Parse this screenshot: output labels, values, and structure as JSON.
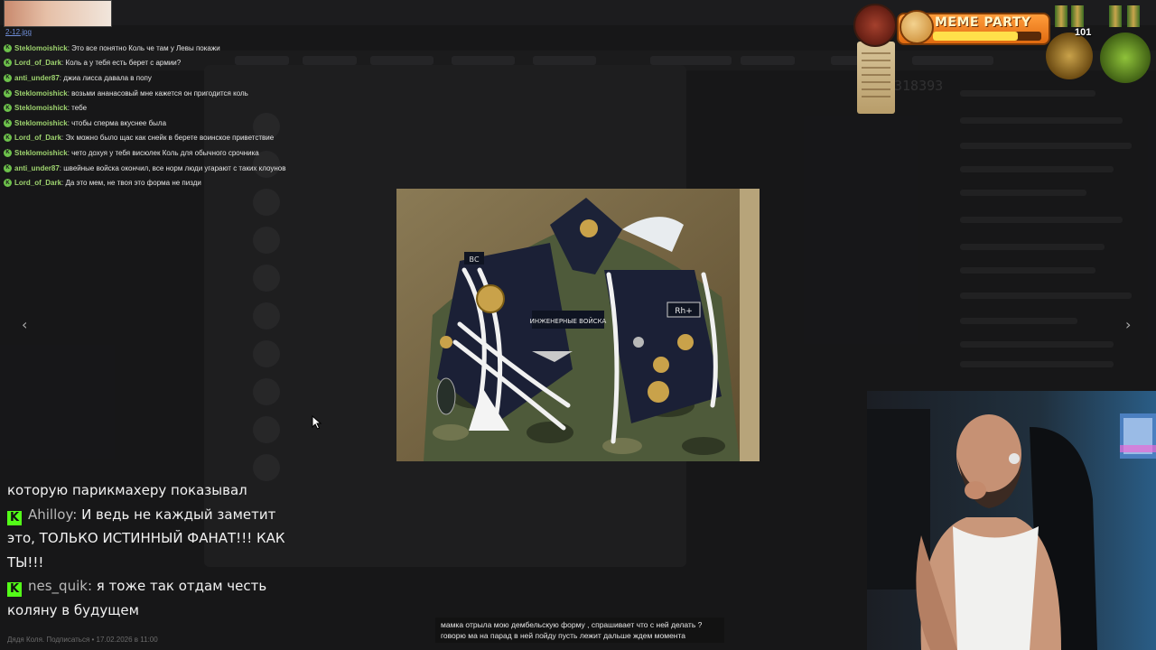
{
  "thumbnail": {
    "filename": "2-12.jpg"
  },
  "small_chat": [
    {
      "user": "Steklomoishick",
      "text": "Это все понятно Коль че там у Левы покажи"
    },
    {
      "user": "Lord_of_Dark",
      "text": "Коль а у тебя есть берет с армии?"
    },
    {
      "user": "anti_under87",
      "text": "джиа лисса давала в попу"
    },
    {
      "user": "Steklomoishick",
      "text": "возьми ананасовый мне кажется он пригодится коль"
    },
    {
      "user": "Steklomoishick",
      "text": "тебе"
    },
    {
      "user": "Steklomoishick",
      "text": "чтобы сперма вкуснее была"
    },
    {
      "user": "Lord_of_Dark",
      "text": "Эх можно было щас как снейк в берете воинское приветствие"
    },
    {
      "user": "Steklomoishick",
      "text": "чето дохуя у тебя висюлек Коль для обычного срочника"
    },
    {
      "user": "anti_under87",
      "text": "швейные войска окончил, все норм люди угарают с таких клоунов"
    },
    {
      "user": "Lord_of_Dark",
      "text": "Да это мем, не твоя это форма не пизди"
    }
  ],
  "big_chat": {
    "carryover": "которую парикмахеру показывал",
    "messages": [
      {
        "user": "Ahilloy",
        "text": "И ведь не каждый заметит это, ТОЛЬКО ИСТИННЫЙ ФАНАТ!!! КАК ТЫ!!!"
      },
      {
        "user": "nes_quik",
        "text": "я тоже так отдам честь коляну в будущем"
      }
    ]
  },
  "photo": {
    "patch_text": "ИНЖЕНЕРНЫЕ ВОЙСКА",
    "badge_text": "Rh+",
    "shoulder_text": "ВС"
  },
  "caption": {
    "line1": "мамка отрыла мою дембельскую форму , спрашивает что с ней делать ?",
    "line2": "говорю ма на парад в ней пойду пусть лежит дальше ждем момента"
  },
  "background": {
    "number": "318393",
    "footer": "Дядя Коля. Подписаться • 17.02.2026 в 11:00"
  },
  "overlay": {
    "meme_label": "MEME PARTY",
    "level": "101",
    "progress": 0.78
  },
  "colors": {
    "chat_user": "#9ed36f",
    "kick_green": "#53fc18",
    "meme_orange": "#e06a10"
  },
  "nav": {
    "prev_icon": "chevron-left-icon",
    "next_icon": "chevron-right-icon"
  }
}
